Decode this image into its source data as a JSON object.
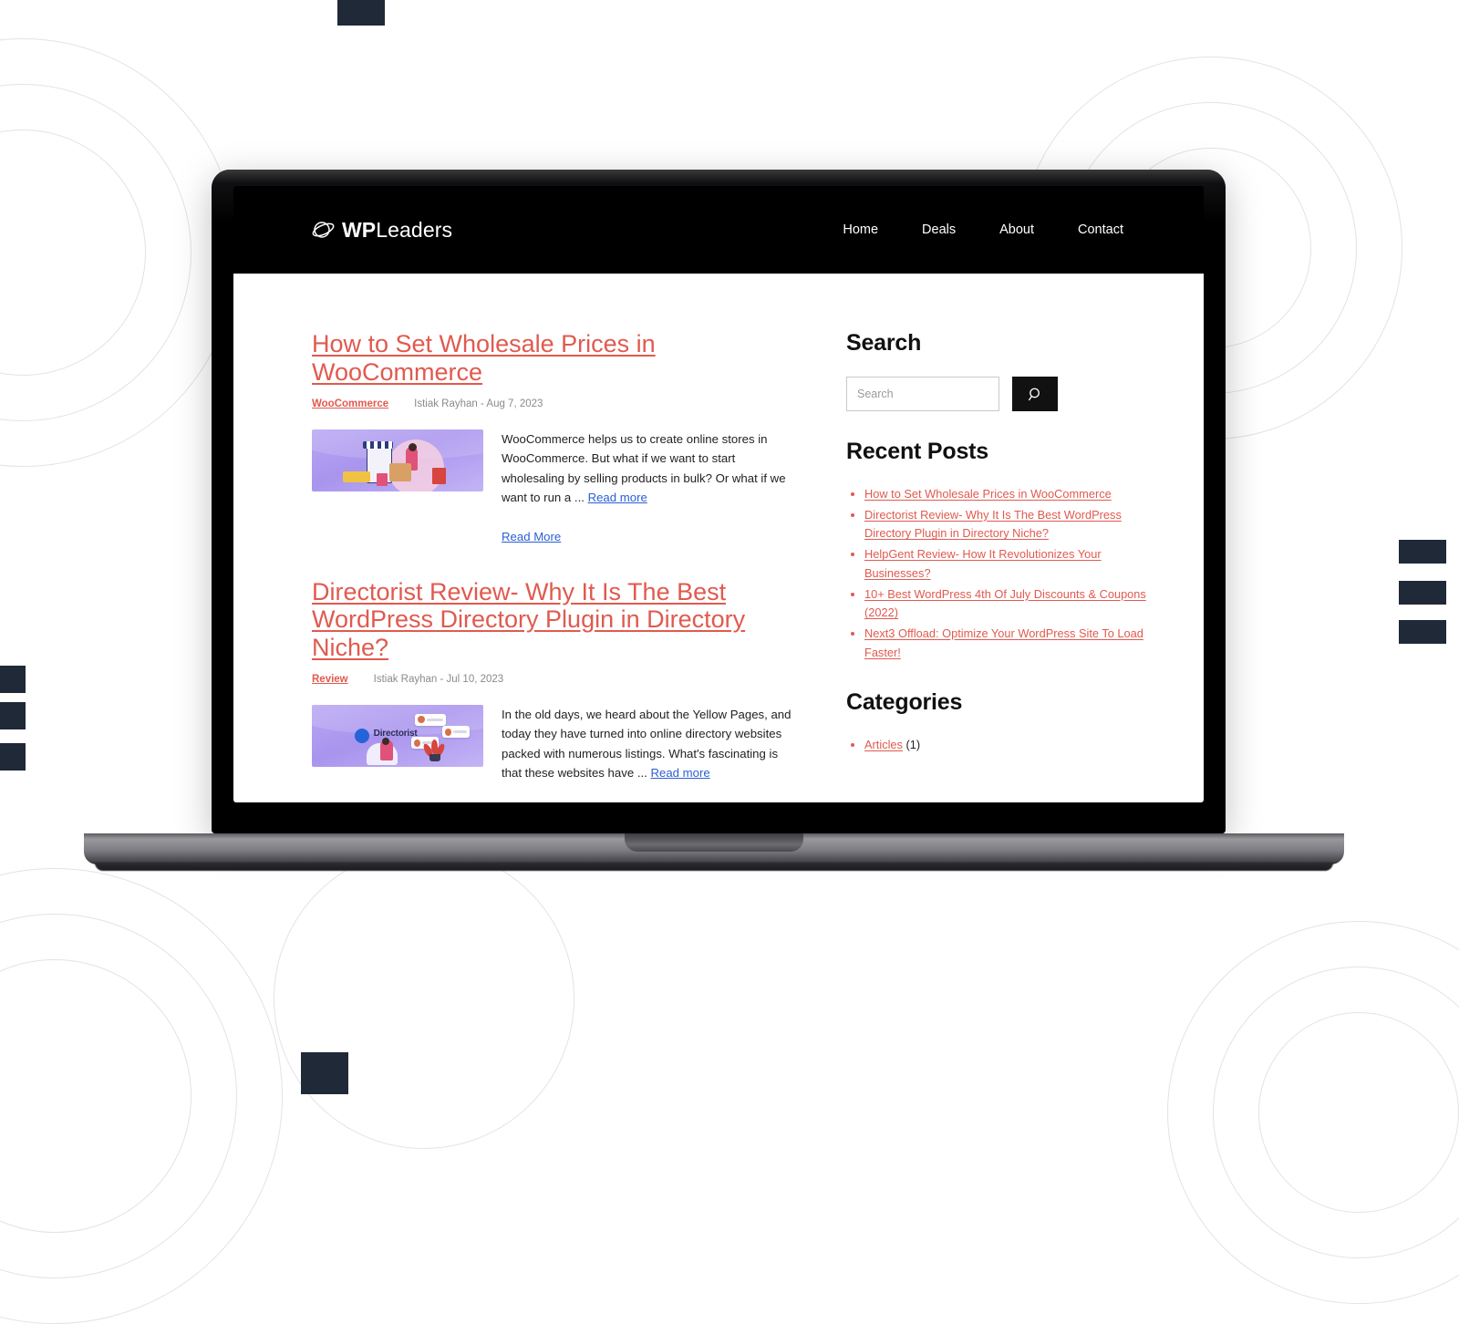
{
  "site": {
    "brand": {
      "bold": "WP",
      "light": "Leaders",
      "logo_icon": "orbit-logo-icon"
    },
    "nav": [
      {
        "label": "Home"
      },
      {
        "label": "Deals"
      },
      {
        "label": "About"
      },
      {
        "label": "Contact"
      }
    ]
  },
  "posts": [
    {
      "title": "How to Set Wholesale Prices in WooCommerce",
      "category": "WooCommerce",
      "byline": "Istiak Rayhan - Aug 7, 2023",
      "excerpt": "WooCommerce helps us to create online stores in WooCommerce. But what if we want to start wholesaling by selling products in bulk? Or what if we want to run a ...",
      "read_more_inline": "Read more",
      "read_more_button": "Read More",
      "thumbnail_alt": "woocommerce-storefront-illustration"
    },
    {
      "title": "Directorist Review- Why It Is The Best WordPress Directory Plugin in Directory Niche?",
      "category": "Review",
      "byline": "Istiak Rayhan - Jul 10, 2023",
      "excerpt": "In the old days, we heard about the Yellow Pages, and today they have turned into online directory websites packed with numerous listings. What's fascinating is that these websites have ...",
      "read_more_inline": "Read more",
      "thumbnail_alt": "directorist-plugin-illustration"
    }
  ],
  "sidebar": {
    "search": {
      "title": "Search",
      "placeholder": "Search",
      "value": "",
      "button_icon": "search-icon"
    },
    "recent_posts": {
      "title": "Recent Posts",
      "items": [
        "How to Set Wholesale Prices in WooCommerce",
        "Directorist Review- Why It Is The Best WordPress Directory Plugin in Directory Niche?",
        "HelpGent Review- How It Revolutionizes Your Businesses?",
        "10+ Best WordPress 4th Of July Discounts & Coupons (2022)",
        "Next3 Offload: Optimize Your WordPress Site To Load Faster!"
      ]
    },
    "categories": {
      "title": "Categories",
      "items": [
        {
          "label": "Articles",
          "count": "(1)"
        }
      ]
    }
  },
  "colors": {
    "accent_red": "#e05a4f",
    "link_blue": "#2b5ed6",
    "header_black": "#000000",
    "decor_navy": "#1f2937"
  }
}
